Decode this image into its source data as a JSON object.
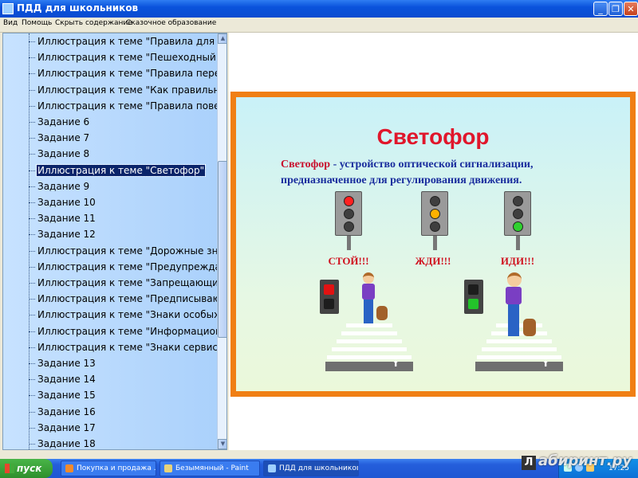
{
  "window": {
    "title": "ПДД для школьников"
  },
  "window_buttons": {
    "minimize": "_",
    "restore": "❐",
    "close": "✕"
  },
  "menu": [
    "Вид",
    "Помощь",
    "Скрыть содержание",
    "Сказочное образование"
  ],
  "toc": {
    "selected_index": 8,
    "items": [
      "Иллюстрация к теме \"Правила для пешеходов\"",
      "Иллюстрация к теме \"Пешеходный переход\"",
      "Иллюстрация к теме \"Правила перехода\"",
      "Иллюстрация к теме \"Как правильно переходить\"",
      "Иллюстрация к теме \"Правила поведения\"",
      "Задание 6",
      "Задание 7",
      "Задание 8",
      "Иллюстрация к теме \"Светофор\"",
      "Задание 9",
      "Задание 10",
      "Задание 11",
      "Задание 12",
      "Иллюстрация к теме \"Дорожные знаки\"",
      "Иллюстрация к теме \"Предупреждающие знаки\"",
      "Иллюстрация к теме \"Запрещающие знаки\"",
      "Иллюстрация к теме \"Предписывающие знаки\"",
      "Иллюстрация к теме \"Знаки особых предписаний\"",
      "Иллюстрация к теме \"Информационные знаки\"",
      "Иллюстрация к теме \"Знаки сервиса\"",
      "Задание 13",
      "Задание 14",
      "Задание 15",
      "Задание 16",
      "Задание 17",
      "Задание 18"
    ],
    "scroll_up": "▲",
    "scroll_down": "▼"
  },
  "slide": {
    "title": "Светофор",
    "desc_term": "Светофор",
    "desc_line1": " - устройство оптической сигнализации,",
    "desc_line2": "предназначенное для регулирования движения.",
    "labels": {
      "stop": "СТОЙ!!!",
      "wait": "ЖДИ!!!",
      "go": "ИДИ!!!"
    },
    "colors": {
      "red": "#ff2020",
      "yellow": "#ffb100",
      "green": "#2fd12f",
      "title": "#e0162b",
      "text": "#1a2e9e",
      "frame": "#f07f14"
    }
  },
  "taskbar": {
    "start_label": "пуск",
    "tasks": [
      "Покупка и продажа ...",
      "Безымянный - Paint",
      "ПДД для школьников"
    ],
    "active_task": 2,
    "clock": "17:25"
  },
  "watermark": {
    "icon": "Л",
    "text": "абиринт.ру"
  }
}
